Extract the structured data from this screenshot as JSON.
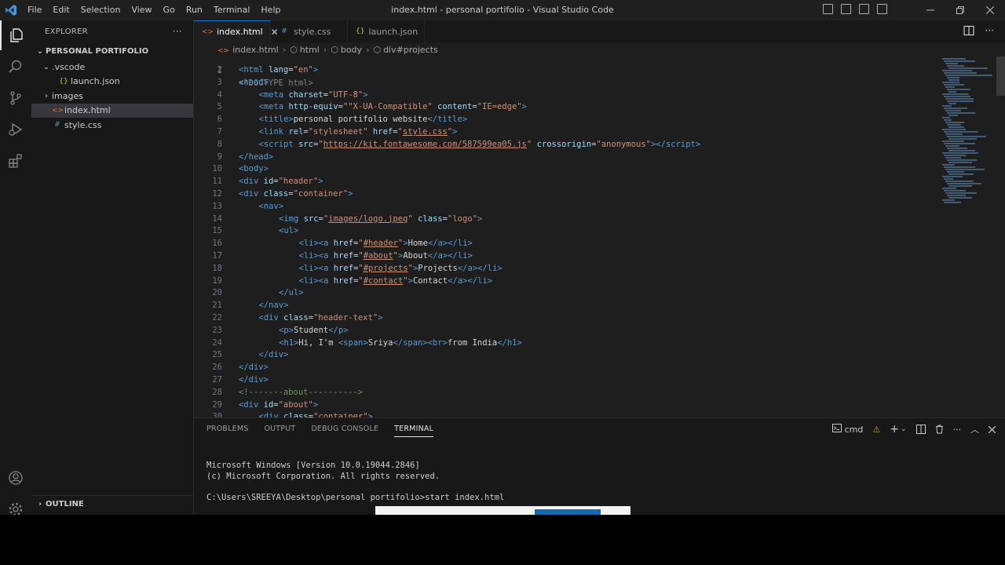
{
  "titlebar": {
    "menu": [
      "File",
      "Edit",
      "Selection",
      "View",
      "Go",
      "Run",
      "Terminal",
      "Help"
    ],
    "window_title": "index.html - personal portifolio - Visual Studio Code"
  },
  "sidebar": {
    "header": "EXPLORER",
    "more": "···",
    "project": "PERSONAL PORTIFOLIO",
    "tree": [
      {
        "label": ".vscode",
        "type": "folder",
        "open": true,
        "depth": 1
      },
      {
        "label": "launch.json",
        "type": "json",
        "depth": 2
      },
      {
        "label": "images",
        "type": "folder",
        "open": false,
        "depth": 1
      },
      {
        "label": "index.html",
        "type": "html",
        "depth": 1,
        "selected": true
      },
      {
        "label": "style.css",
        "type": "css",
        "depth": 1
      }
    ],
    "outline": "OUTLINE"
  },
  "tabs": [
    {
      "label": "index.html",
      "icon": "html-file-icon",
      "active": true
    },
    {
      "label": "style.css",
      "icon": "css-file-icon",
      "active": false
    },
    {
      "label": "launch.json",
      "icon": "json-file-icon",
      "active": false
    }
  ],
  "breadcrumbs": [
    "index.html",
    "html",
    "body",
    "div#projects"
  ],
  "code": {
    "first_line_partial": "<!DOCTYPE html>",
    "lines": [
      {
        "n": 2,
        "indent": 0,
        "html": "<span class=\"n\">&lt;html</span> <span class=\"a\">lang</span><span class=\"x\">=</span><span class=\"s\">\"en\"</span><span class=\"n\">&gt;</span>"
      },
      {
        "n": 3,
        "indent": 0,
        "html": "<span class=\"n\">&lt;head&gt;</span>"
      },
      {
        "n": 4,
        "indent": 1,
        "html": "<span class=\"n\">&lt;meta</span> <span class=\"a\">charset</span><span class=\"x\">=</span><span class=\"s\">\"UTF-8\"</span><span class=\"n\">&gt;</span>"
      },
      {
        "n": 5,
        "indent": 1,
        "html": "<span class=\"n\">&lt;meta</span> <span class=\"a\">http-equiv</span><span class=\"x\">=</span><span class=\"s\">\"\"X-UA-Compatible\"</span> <span class=\"a\">content</span><span class=\"x\">=</span><span class=\"s\">\"IE=edge\"</span><span class=\"n\">&gt;</span>"
      },
      {
        "n": 6,
        "indent": 1,
        "html": "<span class=\"n\">&lt;title&gt;</span><span class=\"x\">personal portifolio website</span><span class=\"n\">&lt;/title&gt;</span>"
      },
      {
        "n": 7,
        "indent": 1,
        "html": "<span class=\"n\">&lt;link</span> <span class=\"a\">rel</span><span class=\"x\">=</span><span class=\"s\">\"stylesheet\"</span> <span class=\"a\">href</span><span class=\"x\">=</span><span class=\"s\">\"<span class=\"u\">style.css</span>\"</span><span class=\"n\">&gt;</span>"
      },
      {
        "n": 8,
        "indent": 1,
        "html": "<span class=\"n\">&lt;script</span> <span class=\"a\">src</span><span class=\"x\">=</span><span class=\"s\">\"<span class=\"u\">https://kit.fontawesome.com/587599ea05.js</span>\"</span> <span class=\"a\">crossorigin</span><span class=\"x\">=</span><span class=\"s\">\"anonymous\"</span><span class=\"n\">&gt;&lt;/script&gt;</span>"
      },
      {
        "n": 9,
        "indent": 0,
        "html": "<span class=\"n\">&lt;/head&gt;</span>"
      },
      {
        "n": 10,
        "indent": 0,
        "html": "<span class=\"n\">&lt;body&gt;</span>"
      },
      {
        "n": 11,
        "indent": 0,
        "html": "<span class=\"n\">&lt;div</span> <span class=\"a\">id</span><span class=\"x\">=</span><span class=\"s\">\"header\"</span><span class=\"n\">&gt;</span>"
      },
      {
        "n": 12,
        "indent": 0,
        "html": "<span class=\"n\">&lt;div</span> <span class=\"a\">class</span><span class=\"x\">=</span><span class=\"s\">\"container\"</span><span class=\"n\">&gt;</span>"
      },
      {
        "n": 13,
        "indent": 1,
        "html": "<span class=\"n\">&lt;nav&gt;</span>"
      },
      {
        "n": 14,
        "indent": 2,
        "html": "<span class=\"n\">&lt;img</span> <span class=\"a\">src</span><span class=\"x\">=</span><span class=\"s\">\"<span class=\"u\">images/logo.jpeg</span>\"</span> <span class=\"a\">class</span><span class=\"x\">=</span><span class=\"s\">\"logo\"</span><span class=\"n\">&gt;</span>"
      },
      {
        "n": 15,
        "indent": 2,
        "html": "<span class=\"n\">&lt;ul&gt;</span>"
      },
      {
        "n": 16,
        "indent": 3,
        "html": "<span class=\"n\">&lt;li&gt;&lt;a</span> <span class=\"a\">href</span><span class=\"x\">=</span><span class=\"s\">\"<span class=\"u\">#header</span>\"</span><span class=\"n\">&gt;</span><span class=\"x\">Home</span><span class=\"n\">&lt;/a&gt;&lt;/li&gt;</span>"
      },
      {
        "n": 17,
        "indent": 3,
        "html": "<span class=\"n\">&lt;li&gt;&lt;a</span> <span class=\"a\">href</span><span class=\"x\">=</span><span class=\"s\">\"<span class=\"u\">#about</span>\"</span><span class=\"n\">&gt;</span><span class=\"x\">About</span><span class=\"n\">&lt;/a&gt;&lt;/li&gt;</span>"
      },
      {
        "n": 18,
        "indent": 3,
        "html": "<span class=\"n\">&lt;li&gt;&lt;a</span> <span class=\"a\">href</span><span class=\"x\">=</span><span class=\"s\">\"<span class=\"u\">#projects</span>\"</span><span class=\"n\">&gt;</span><span class=\"x\">Projects</span><span class=\"n\">&lt;/a&gt;&lt;/li&gt;</span>"
      },
      {
        "n": 19,
        "indent": 3,
        "html": "<span class=\"n\">&lt;li&gt;&lt;a</span> <span class=\"a\">href</span><span class=\"x\">=</span><span class=\"s\">\"<span class=\"u\">#contact</span>\"</span><span class=\"n\">&gt;</span><span class=\"x\">Contact</span><span class=\"n\">&lt;/a&gt;&lt;/li&gt;</span>"
      },
      {
        "n": 20,
        "indent": 2,
        "html": "<span class=\"n\">&lt;/ul&gt;</span>"
      },
      {
        "n": 21,
        "indent": 1,
        "html": "<span class=\"n\">&lt;/nav&gt;</span>"
      },
      {
        "n": 22,
        "indent": 1,
        "html": "<span class=\"n\">&lt;div</span> <span class=\"a\">class</span><span class=\"x\">=</span><span class=\"s\">\"header-text\"</span><span class=\"n\">&gt;</span>"
      },
      {
        "n": 23,
        "indent": 2,
        "html": "<span class=\"n\">&lt;p&gt;</span><span class=\"x\">Student</span><span class=\"n\">&lt;/p&gt;</span>"
      },
      {
        "n": 24,
        "indent": 2,
        "html": "<span class=\"n\">&lt;h1&gt;</span><span class=\"x\">Hi, I'm </span><span class=\"n\">&lt;span&gt;</span><span class=\"x\">Sriya</span><span class=\"n\">&lt;/span&gt;&lt;br&gt;</span><span class=\"x\">from India</span><span class=\"n\">&lt;/h1&gt;</span>"
      },
      {
        "n": 25,
        "indent": 1,
        "html": "<span class=\"n\">&lt;/div&gt;</span>"
      },
      {
        "n": 26,
        "indent": 0,
        "html": "<span class=\"n\">&lt;/div&gt;</span>"
      },
      {
        "n": 27,
        "indent": 0,
        "html": "<span class=\"n\">&lt;/div&gt;</span>"
      },
      {
        "n": 28,
        "indent": 0,
        "html": "<span class=\"c\">&lt;!-------about----------&gt;</span>"
      },
      {
        "n": 29,
        "indent": 0,
        "html": "<span class=\"n\">&lt;div</span> <span class=\"a\">id</span><span class=\"x\">=</span><span class=\"s\">\"about\"</span><span class=\"n\">&gt;</span>"
      },
      {
        "n": 30,
        "indent": 1,
        "html": "<span class=\"n\">&lt;div</span> <span class=\"a\">class</span><span class=\"x\">=</span><span class=\"s\">\"container\"</span><span class=\"n\">&gt;</span>"
      }
    ]
  },
  "panel": {
    "tabs": [
      {
        "label": "PROBLEMS",
        "active": false
      },
      {
        "label": "OUTPUT",
        "active": false
      },
      {
        "label": "DEBUG CONSOLE",
        "active": false
      },
      {
        "label": "TERMINAL",
        "active": true
      }
    ],
    "shell_label": "cmd",
    "terminal_lines": [
      "Microsoft Windows [Version 10.0.19044.2846]",
      "(c) Microsoft Corporation. All rights reserved.",
      "",
      "C:\\Users\\SREEYA\\Desktop\\personal portifolio>start index.html"
    ]
  },
  "colors": {
    "accent": "#0078d4",
    "editor_bg": "#1e1e1e",
    "sidebar_bg": "#181818",
    "tag": "#569cd6",
    "attr": "#9cdcfe",
    "string": "#ce9178"
  }
}
